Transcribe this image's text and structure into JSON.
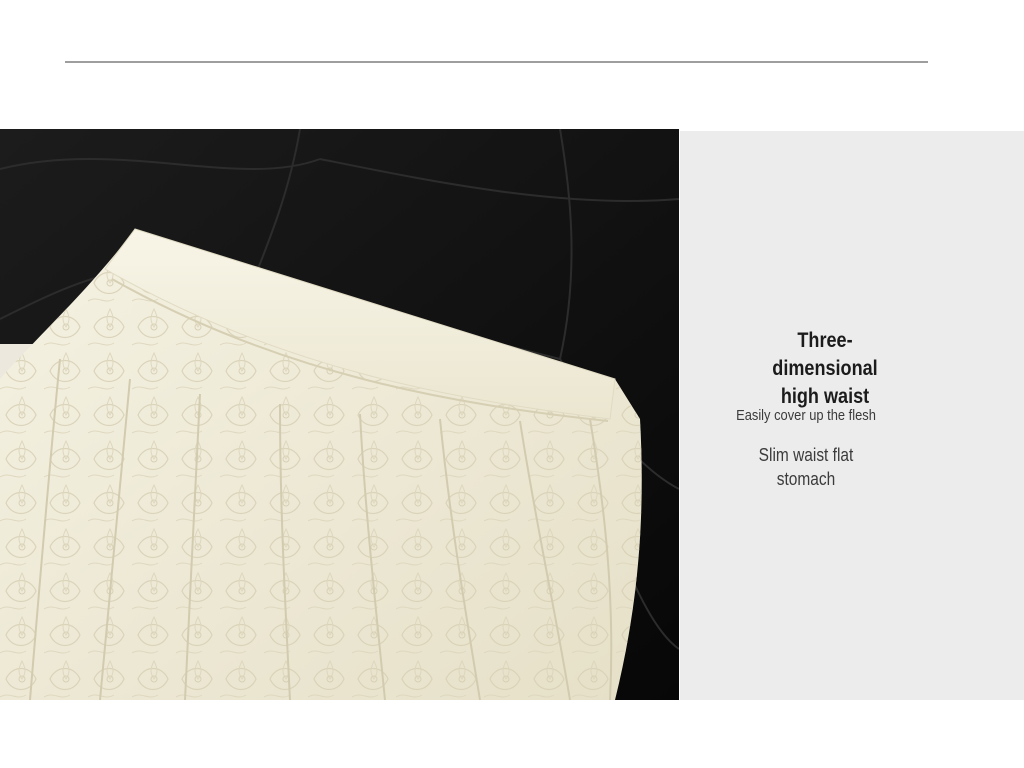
{
  "feature": {
    "heading_line1": "Three-dimensional",
    "heading_line2": "high waist",
    "subtitle": "Easily cover up the flesh",
    "detail_line1": "Slim waist flat",
    "detail_line2": "stomach"
  },
  "colors": {
    "rule": "#9e9e9e",
    "panel_background": "#ececec",
    "photo_background": "#101010",
    "fabric": "#f3efdf",
    "heading_text": "#1b1b1b",
    "body_text": "#3b3b3b"
  }
}
